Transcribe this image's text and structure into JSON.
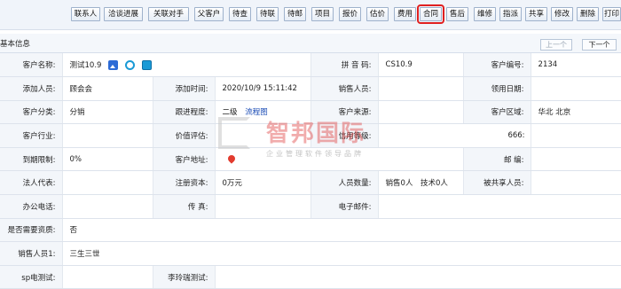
{
  "toolbar": {
    "buttons": [
      "联系人",
      "洽谈进展",
      "关联对手",
      "父客户",
      "待查",
      "待联",
      "待邮",
      "项目",
      "报价",
      "估价",
      "费用",
      "合同",
      "售后",
      "维修",
      "指派",
      "共享",
      "修改",
      "删除",
      "打印"
    ],
    "highlighted": "合同",
    "highlight_color": "#e02020"
  },
  "section": {
    "title": "基本信息",
    "prev_label": "上一个",
    "next_label": "下一个"
  },
  "form": {
    "customer_name_label": "客户名称:",
    "customer_name_value": "测试10.9",
    "pinyin_label": "拼 音 码:",
    "pinyin_value": "CS10.9",
    "customer_no_label": "客户编号:",
    "customer_no_value": "2134",
    "added_by_label": "添加人员:",
    "added_by_value": "顾会会",
    "added_time_label": "添加时间:",
    "added_time_value": "2020/10/9 15:11:42",
    "sales_label": "销售人员:",
    "sales_value": "",
    "claim_date_label": "领用日期:",
    "claim_date_value": "",
    "category_label": "客户分类:",
    "category_value": "分销",
    "follow_label": "跟进程度:",
    "follow_level": "二级",
    "follow_link": "流程图",
    "source_label": "客户来源:",
    "source_value": "",
    "region_label": "客户区域:",
    "region_value": "华北 北京",
    "industry_label": "客户行业:",
    "industry_value": "",
    "value_eval_label": "价值评估:",
    "value_eval_value": "",
    "credit_label": "信用等级:",
    "credit_value": "666:",
    "expire_label": "到期限制:",
    "expire_value": "0%",
    "address_label": "客户地址:",
    "postcode_label": "邮 编:",
    "postcode_value": "",
    "legal_rep_label": "法人代表:",
    "legal_rep_value": "",
    "capital_label": "注册资本:",
    "capital_value": "0万元",
    "staff_label": "人员数量:",
    "staff_value": "销售0人　技术0人",
    "shared_label": "被共享人员:",
    "shared_value": "",
    "office_phone_label": "办公电话:",
    "office_phone_value": "",
    "fax_label": "传 真:",
    "fax_value": "",
    "email_label": "电子邮件:",
    "email_value": "",
    "need_qual_label": "是否需要资质:",
    "need_qual_value": "否",
    "sales1_label": "销售人员1:",
    "sales1_value": "三生三世",
    "sp_label": "sp电测试:",
    "sp_value": "",
    "lee_label": "李玲瑞测试:",
    "lee_value": ""
  },
  "icons": {
    "name_icons": [
      "image-icon",
      "browser-icon",
      "web-icon"
    ],
    "address_icon": "map-pin-icon"
  },
  "watermark": {
    "title": "智邦国际",
    "subtitle": "企业管理软件领导品牌"
  }
}
